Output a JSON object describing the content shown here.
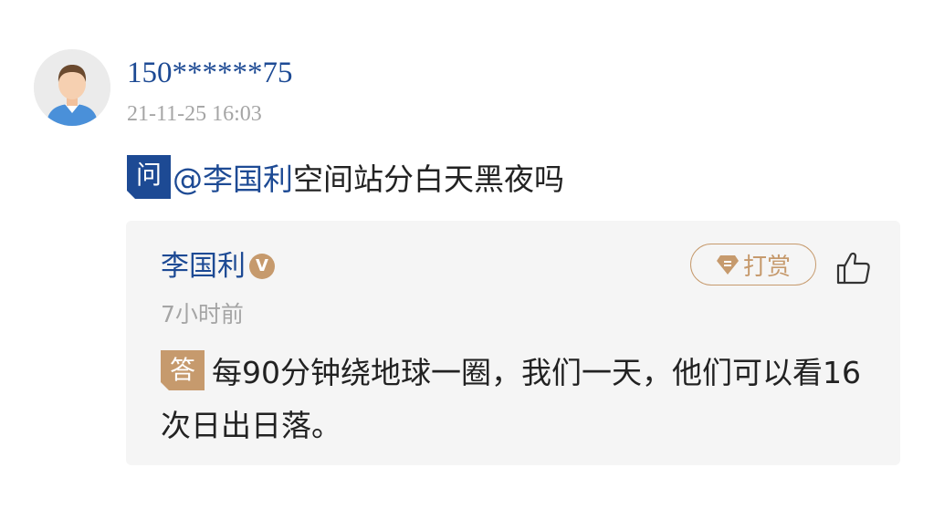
{
  "comment": {
    "username": "150******75",
    "timestamp": "21-11-25 16:03",
    "avatar_icon": "default-male-avatar-icon"
  },
  "question": {
    "badge": "问",
    "mention": "@李国利",
    "text": "空间站分白天黑夜吗"
  },
  "answer": {
    "answerer_name": "李国利",
    "verified_badge": "V",
    "time": "7小时前",
    "tip_label": "打赏",
    "tip_icon": "diamond-icon",
    "like_icon": "thumbs-up-icon",
    "badge": "答",
    "text": "每90分钟绕地球一圈，我们一天，他们可以看16次日出日落。"
  },
  "colors": {
    "brand_blue": "#1d4a94",
    "gold": "#c69a6d",
    "muted_gray": "#a5a5a5",
    "card_bg": "#f5f5f5"
  }
}
